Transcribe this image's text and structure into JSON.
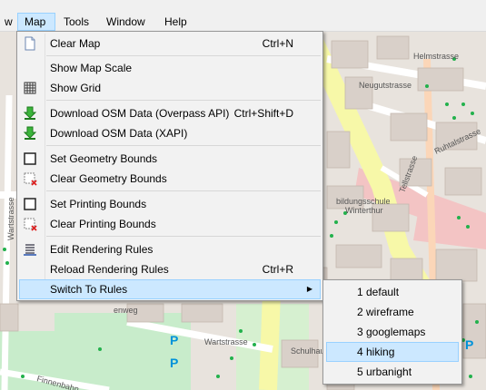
{
  "menubar": {
    "items": [
      {
        "label": "w"
      },
      {
        "label": "Map"
      },
      {
        "label": "Tools"
      },
      {
        "label": "Window"
      },
      {
        "label": "Help"
      }
    ]
  },
  "map_menu": {
    "items": [
      {
        "label": "Clear Map",
        "shortcut": "Ctrl+N",
        "icon": "new-document-icon"
      },
      {
        "label": "Show Map Scale",
        "shortcut": "",
        "icon": ""
      },
      {
        "label": "Show Grid",
        "shortcut": "",
        "icon": "grid-icon"
      },
      {
        "label": "Download OSM Data (Overpass API)",
        "shortcut": "Ctrl+Shift+D",
        "icon": "download-arrow-icon"
      },
      {
        "label": "Download OSM Data (XAPI)",
        "shortcut": "",
        "icon": "download-arrow-icon"
      },
      {
        "label": "Set Geometry Bounds",
        "shortcut": "",
        "icon": "bounds-square-icon"
      },
      {
        "label": "Clear Geometry Bounds",
        "shortcut": "",
        "icon": "clear-bounds-icon"
      },
      {
        "label": "Set Printing Bounds",
        "shortcut": "",
        "icon": "bounds-square-icon"
      },
      {
        "label": "Clear Printing Bounds",
        "shortcut": "",
        "icon": "clear-bounds-icon"
      },
      {
        "label": "Edit Rendering Rules",
        "shortcut": "",
        "icon": "rules-list-icon"
      },
      {
        "label": "Reload Rendering Rules",
        "shortcut": "Ctrl+R",
        "icon": ""
      },
      {
        "label": "Switch To Rules",
        "shortcut": "",
        "icon": ""
      }
    ]
  },
  "rules_submenu": {
    "items": [
      {
        "label": "1 default"
      },
      {
        "label": "2 wireframe"
      },
      {
        "label": "3 googlemaps"
      },
      {
        "label": "4 hiking"
      },
      {
        "label": "5 urbanight"
      }
    ],
    "highlighted": "4 hiking"
  },
  "map_labels": {
    "streets": [
      "Neugutstrasse",
      "Ruhtalstrasse",
      "Tellstrasse",
      "Wartstrasse",
      "Wartstrasse",
      "Schulhaus",
      "Finnenbahn",
      "enweg",
      "Helmstrasse",
      "Wartstr"
    ],
    "places": [
      "bildungsschule",
      "Winterthur"
    ],
    "parking": [
      "P",
      "P",
      "P"
    ]
  },
  "colors": {
    "menubar_bg": "#f0f0f0",
    "menu_bg": "#f2f2f2",
    "highlight_bg": "#cce8ff",
    "highlight_border": "#99d1ff",
    "map_bg": "#e6e2dc",
    "building": "#d9d0c9",
    "road_yellow": "#f7f8a8",
    "park_green": "#c8eccb",
    "pedestrian_pink": "#f3c4c4"
  }
}
